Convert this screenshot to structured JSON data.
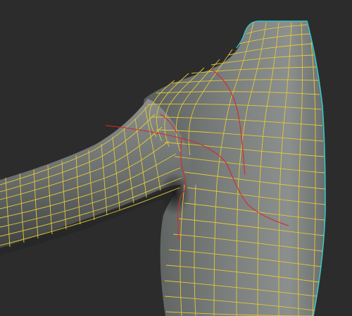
{
  "viewport": {
    "background_color": "#2c2c2c"
  },
  "mesh": {
    "subject": "shoulder-and-arm",
    "wire_color": "#e3c93a",
    "seam_color": "#d42a2a",
    "border_color": "#38c6c9",
    "surface_color_light": "#888c8a",
    "surface_color_dark": "#3f4240"
  }
}
